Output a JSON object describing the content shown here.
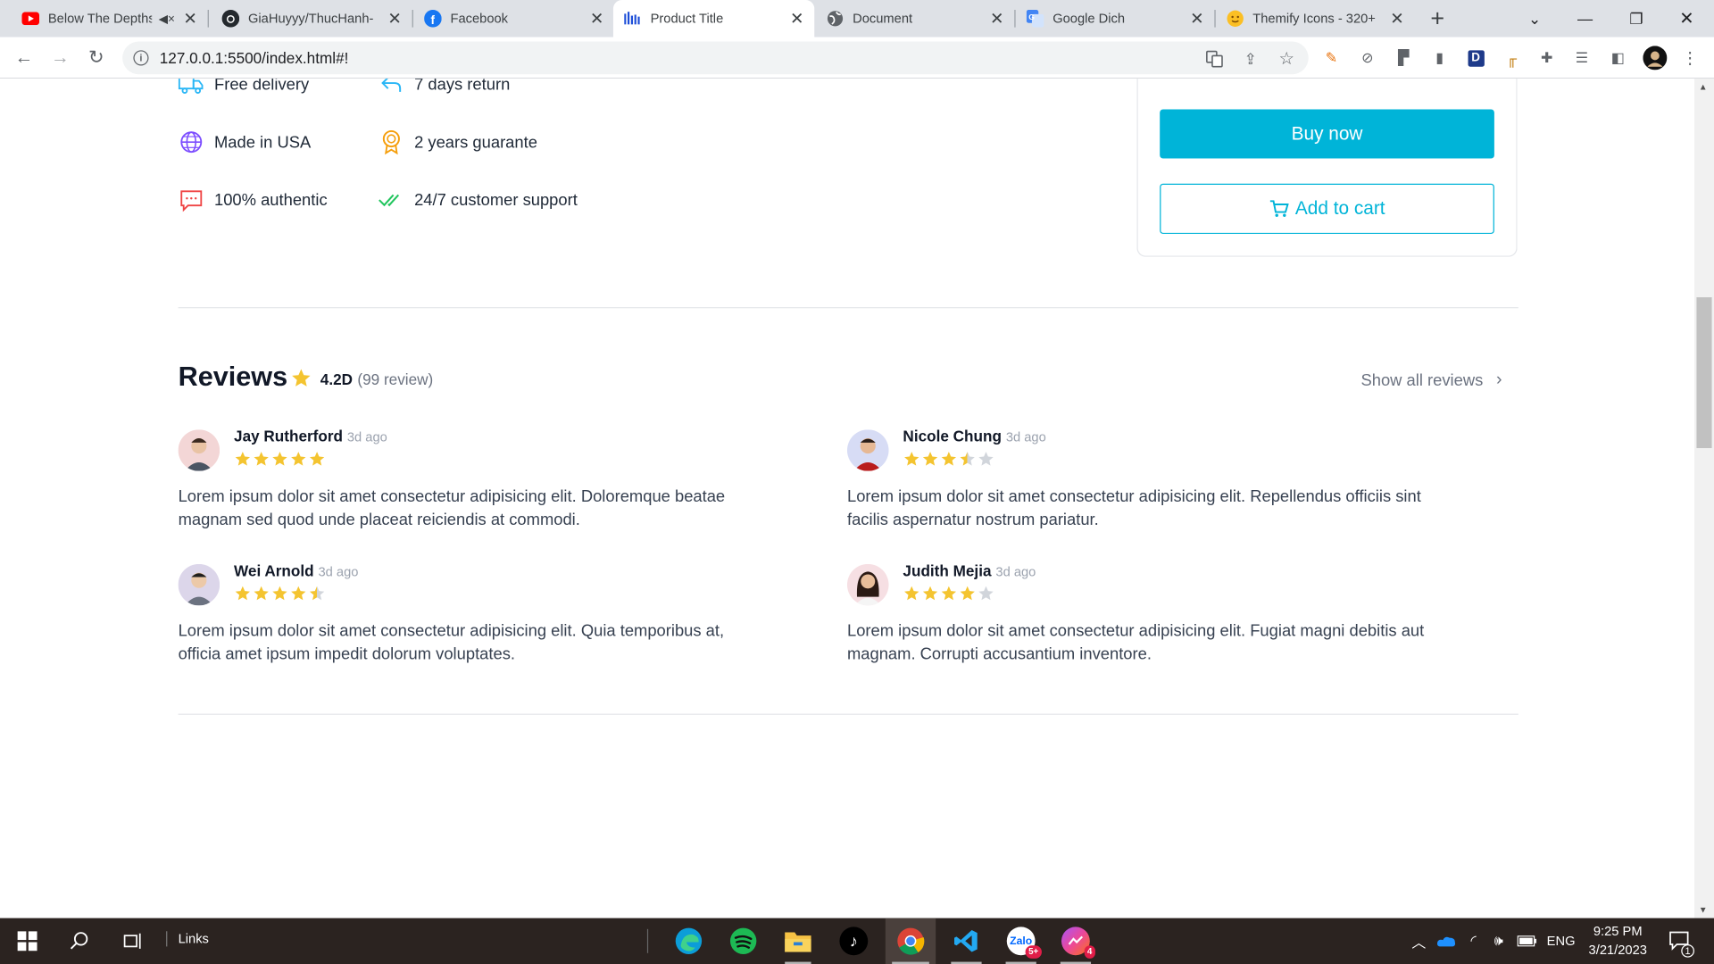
{
  "browser": {
    "tabs": [
      {
        "title": "Below The Depths",
        "favicon": "youtube-icon",
        "muted": true
      },
      {
        "title": "GiaHuyyy/ThucHanh-",
        "favicon": "github-icon"
      },
      {
        "title": "Facebook",
        "favicon": "facebook-icon"
      },
      {
        "title": "Product Title",
        "favicon": "site-logo-icon",
        "active": true
      },
      {
        "title": "Document",
        "favicon": "globe-icon"
      },
      {
        "title": "Google Dich",
        "favicon": "google-translate-icon"
      },
      {
        "title": "Themify Icons - 320+",
        "favicon": "emoji-icon"
      }
    ],
    "url": "127.0.0.1:5500/index.html#!"
  },
  "features": [
    {
      "label": "Free delivery",
      "icon": "truck-icon"
    },
    {
      "label": "7 days return",
      "icon": "return-arrow-icon"
    },
    {
      "label": "Made in USA",
      "icon": "globe-icon"
    },
    {
      "label": "2 years guarante",
      "icon": "award-icon"
    },
    {
      "label": "100% authentic",
      "icon": "chat-icon"
    },
    {
      "label": "24/7 customer support",
      "icon": "double-check-icon"
    }
  ],
  "purchase": {
    "buy_label": "Buy now",
    "cart_label": "Add to cart"
  },
  "reviews": {
    "title": "Reviews",
    "score": "4.2D",
    "count_text": "(99 review)",
    "show_all": "Show all reviews",
    "items": [
      {
        "name": "Jay Rutherford",
        "ago": "3d ago",
        "rating": 5,
        "text": "Lorem ipsum dolor sit amet consectetur adipisicing elit. Doloremque beatae magnam sed quod unde placeat reiciendis at commodi."
      },
      {
        "name": "Nicole Chung",
        "ago": "3d ago",
        "rating": 3.5,
        "text": "Lorem ipsum dolor sit amet consectetur adipisicing elit. Repellendus officiis sint facilis aspernatur nostrum pariatur."
      },
      {
        "name": "Wei Arnold",
        "ago": "3d ago",
        "rating": 4.5,
        "text": "Lorem ipsum dolor sit amet consectetur adipisicing elit. Quia temporibus at, officia amet ipsum impedit dolorum voluptates."
      },
      {
        "name": "Judith Mejia",
        "ago": "3d ago",
        "rating": 4,
        "text": "Lorem ipsum dolor sit amet consectetur adipisicing elit. Fugiat magni debitis aut magnam. Corrupti accusantium inventore."
      }
    ]
  },
  "taskbar": {
    "links_label": "Links",
    "language": "ENG",
    "time": "9:25 PM",
    "date": "3/21/2023",
    "notification_count": "1",
    "zalo_badge": "5+",
    "messenger_badge": "4"
  },
  "colors": {
    "accent": "#00b4d8",
    "star": "#f4c430",
    "star_empty": "#d1d5db"
  }
}
